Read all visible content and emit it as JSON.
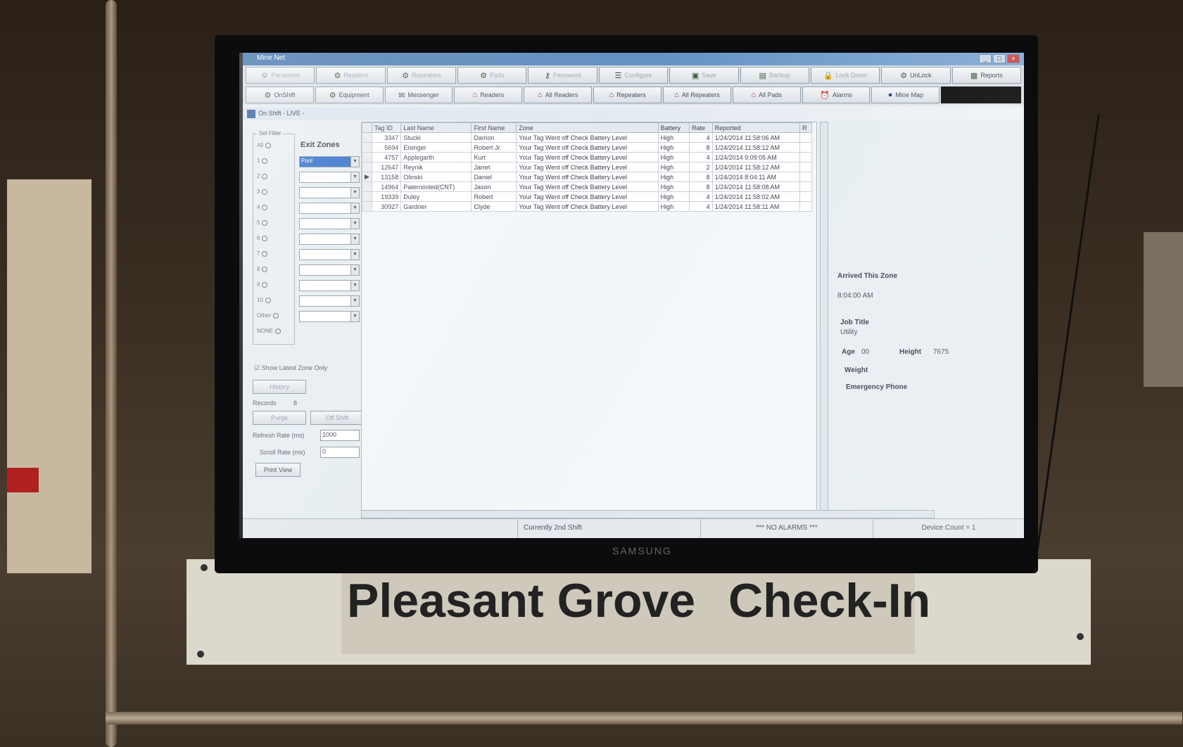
{
  "window": {
    "title": "Mine Net"
  },
  "toolbar_top": [
    {
      "label": "Personnel",
      "icon": "person-icon",
      "enabled": false
    },
    {
      "label": "Readers",
      "icon": "reader-icon",
      "enabled": false
    },
    {
      "label": "Repeaters",
      "icon": "repeater-icon",
      "enabled": false
    },
    {
      "label": "Pads",
      "icon": "pad-icon",
      "enabled": false
    },
    {
      "label": "Password",
      "icon": "key-icon",
      "enabled": false
    },
    {
      "label": "Configure",
      "icon": "configure-icon",
      "enabled": false
    },
    {
      "label": "Save",
      "icon": "save-icon",
      "enabled": false
    },
    {
      "label": "Backup",
      "icon": "backup-icon",
      "enabled": false
    },
    {
      "label": "Lock Down",
      "icon": "lock-icon",
      "enabled": false
    },
    {
      "label": "UnLock",
      "icon": "unlock-icon",
      "enabled": true
    },
    {
      "label": "Reports",
      "icon": "reports-icon",
      "enabled": true
    }
  ],
  "toolbar_bottom": [
    {
      "label": "OnShift",
      "icon": "onshift-icon"
    },
    {
      "label": "Equipment",
      "icon": "equipment-icon"
    },
    {
      "label": "Messenger",
      "icon": "messenger-icon"
    },
    {
      "label": "Readers",
      "icon": "reader-house-icon"
    },
    {
      "label": "All Readers",
      "icon": "reader-house-icon"
    },
    {
      "label": "Repeaters",
      "icon": "repeater-house-icon"
    },
    {
      "label": "All Repeaters",
      "icon": "repeater-house-icon"
    },
    {
      "label": "All Pads",
      "icon": "pad-house-icon"
    },
    {
      "label": "Alarms",
      "icon": "alarm-icon"
    },
    {
      "label": "Mine Map",
      "icon": "globe-icon"
    }
  ],
  "child_window": {
    "title": "On Shift - LIVE -"
  },
  "filter": {
    "legend": "Sel Filter",
    "exit_zones_label": "Exit Zones",
    "options": [
      "All",
      "1",
      "2",
      "3",
      "4",
      "5",
      "6",
      "7",
      "8",
      "9",
      "10",
      "Other",
      "NONE"
    ],
    "selected_zone": "Pool"
  },
  "controls": {
    "show_latest_label": "Show Latest Zone Only",
    "history_button": "History",
    "records_label": "Records",
    "records_value": "8",
    "purge_button": "Purge",
    "off_shift_button": "Off Shift",
    "refresh_label": "Refresh Rate (ms)",
    "refresh_value": "1000",
    "scroll_label": "Scroll Rate (ms)",
    "scroll_value": "0",
    "print_button": "Print View"
  },
  "table": {
    "columns": [
      "Tag ID",
      "Last Name",
      "First Name",
      "Zone",
      "Battery",
      "Rate",
      "Reported",
      "R"
    ],
    "rows": [
      [
        "3347",
        "Stucki",
        "Damon",
        "Your Tag Went off Check Battery Level",
        "High",
        "4",
        "1/24/2014 11:58:06 AM"
      ],
      [
        "5694",
        "Eisinger",
        "Robert Jr.",
        "Your Tag Went off Check Battery Level",
        "High",
        "8",
        "1/24/2014 11:58:12 AM"
      ],
      [
        "4757",
        "Applegarth",
        "Kurt",
        "Your Tag Went off Check Battery Level",
        "High",
        "4",
        "1/24/2014 9:09:05 AM"
      ],
      [
        "12647",
        "Reynik",
        "Jarret",
        "Your Tag Went off Check Battery Level",
        "High",
        "2",
        "1/24/2014 11:58:12 AM"
      ],
      [
        "13158",
        "Olinski",
        "Daniel",
        "Your Tag Went off Check Battery Level",
        "High",
        "8",
        "1/24/2014 8:04:11 AM"
      ],
      [
        "14964",
        "Paternosted(CNT)",
        "Jason",
        "Your Tag Went off Check Battery Level",
        "High",
        "8",
        "1/24/2014 11:58:08 AM"
      ],
      [
        "19339",
        "Duley",
        "Robert",
        "Your Tag Went off Check Battery Level",
        "High",
        "4",
        "1/24/2014 11:58:02 AM"
      ],
      [
        "30927",
        "Gardner",
        "Clyde",
        "Your Tag Went off Check Battery Level",
        "High",
        "4",
        "1/24/2014 11:58:11 AM"
      ]
    ]
  },
  "detail": {
    "arrived_label": "Arrived This Zone",
    "arrived_value": "8:04:00 AM",
    "job_title_label": "Job Title",
    "job_title_value": "Utility",
    "age_label": "Age",
    "age_value": "00",
    "height_label": "Height",
    "height_value": "7675",
    "weight_label": "Weight",
    "emergency_label": "Emergency Phone"
  },
  "status": {
    "shift": "Currently 2nd Shift",
    "alarms": "*** NO ALARMS ***",
    "device_count": "Device Count = 1"
  },
  "monitor": {
    "brand": "SAMSUNG"
  },
  "sign": {
    "left": "Pleasant Grove",
    "right": "Check-In"
  }
}
